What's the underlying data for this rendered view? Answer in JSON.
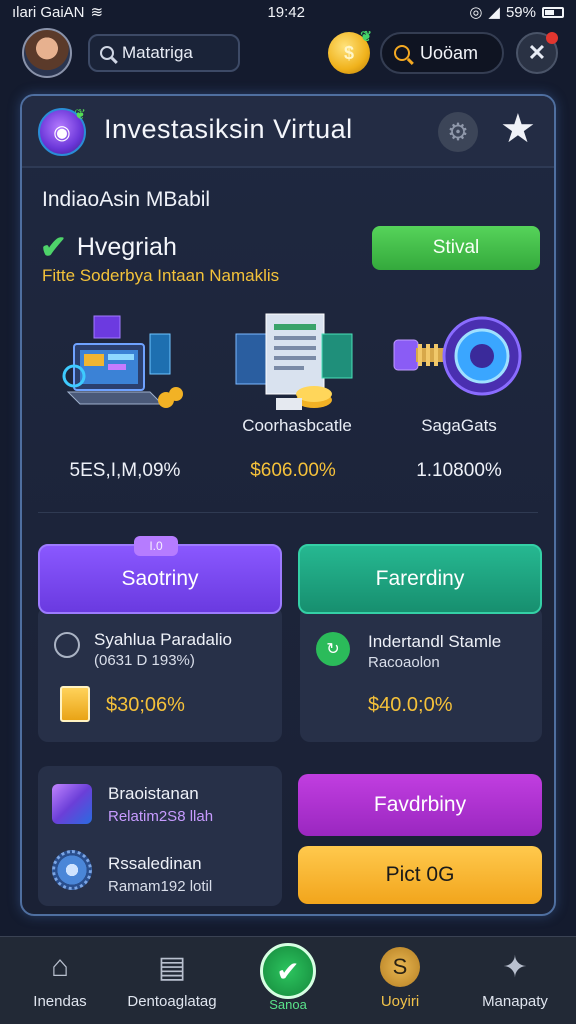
{
  "status_bar": {
    "left_text": "ılari GaiAN",
    "time": "19:42",
    "battery_text": "59%"
  },
  "top_bar": {
    "search_value": "Matatriga",
    "pill_label": "Uoöam"
  },
  "panel": {
    "title": "Investasiksin Virtual",
    "section_heading": "IndiaoAsin MBabil",
    "check_label": "Hvegriah",
    "subtitle": "Fitte Soderbya Intaan Namaklis",
    "status_button": "Stival",
    "items": [
      {
        "label": "",
        "stat": "5ES,I,M,09%"
      },
      {
        "label": "Coorhasbcatle",
        "stat": "$606.00%"
      },
      {
        "label": "SagaGats",
        "stat": "1.10800%"
      }
    ],
    "purple_button": "Saotriny",
    "purple_tag": "I.0",
    "teal_button": "Farerdiny",
    "card_left": {
      "title": "Syahlua Paradalio",
      "sub": "(0631 D 193%)",
      "price": "$30;06%"
    },
    "card_right": {
      "title": "Indertandl Stamle",
      "sub": "Racoaolon",
      "price": "$40.0;0%"
    },
    "card_bottom": {
      "row1_title": "Braoistanan",
      "row1_sub": "Relatim2S8 llah",
      "row2_title": "Rssaledinan",
      "row2_sub": "Ramam192 lotil"
    },
    "magenta_button": "Favdrbiny",
    "orange_button": "Pict 0G"
  },
  "bottom_nav": [
    {
      "label": "Inendas",
      "icon": "home-icon"
    },
    {
      "label": "Dentoaglatag",
      "icon": "document-icon"
    },
    {
      "label": "Sanoa",
      "icon": "checkmark-icon"
    },
    {
      "label": "Uoyiri",
      "icon": "coin-icon"
    },
    {
      "label": "Manapaty",
      "icon": "star-icon"
    }
  ],
  "colors": {
    "background": "#141b2e",
    "accent_green": "#4ed36a",
    "accent_gold": "#f5c13a",
    "accent_purple": "#7a48f0",
    "accent_teal": "#1fa882"
  }
}
